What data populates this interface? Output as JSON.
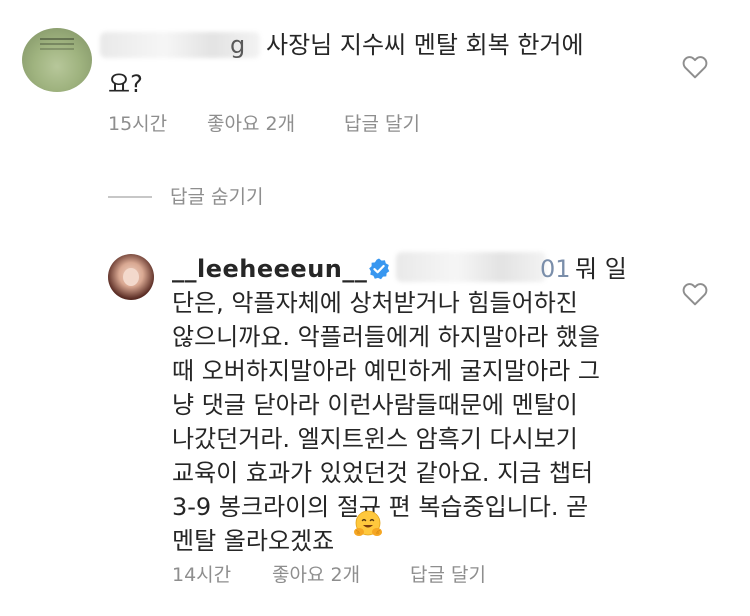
{
  "comment1": {
    "text_line1": "사장님 지수씨 멘탈 회복 한거에",
    "text_line2": "요?",
    "username_fragment": "g",
    "time": "15시간",
    "likes": "좋아요 2개",
    "reply": "답글 달기"
  },
  "replies_toggle": {
    "label": "답글 숨기기"
  },
  "comment2": {
    "username": "__leeheeeun__",
    "mention_fragment": "01",
    "lines": [
      "뭐 일",
      "단은, 악플자체에 상처받거나 힘들어하진",
      "않으니까요. 악플러들에게 하지말아라 했을",
      "때 오버하지말아라 예민하게 굴지말아라 그",
      "냥 댓글 닫아라 이런사람들때문에 멘탈이",
      "나갔던거라. 엘지트윈스 암흑기 다시보기",
      "교육이 효과가 있었던것 같아요. 지금 챕터",
      "3-9 봉크라이의 절규 편 복습중입니다. 곧",
      "멘탈 올라오겠죠"
    ],
    "emoji": "hugging-face-emoji",
    "time": "14시간",
    "likes": "좋아요 2개",
    "reply": "답글 달기"
  },
  "colors": {
    "text": "#262626",
    "meta": "#8e8e8e",
    "verified": "#3897f0",
    "mention": "#003569"
  }
}
